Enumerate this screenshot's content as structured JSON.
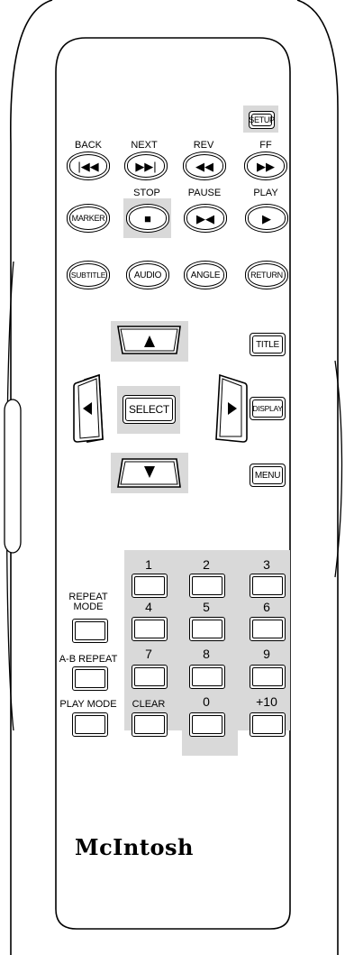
{
  "brand": "McIntosh",
  "labels": {
    "back": "BACK",
    "next": "NEXT",
    "rev": "REV",
    "ff": "FF",
    "stop": "STOP",
    "pause": "PAUSE",
    "play": "PLAY",
    "repeat_mode": "REPEAT\nMODE",
    "ab_repeat": "A-B  REPEAT"
  },
  "buttons": {
    "setup": "SETUP",
    "marker": "MARKER",
    "subtitle": "SUBTITLE",
    "audio": "AUDIO",
    "angle": "ANGLE",
    "return": "RETURN",
    "title": "TITLE",
    "display": "DISPLAY",
    "menu": "MENU",
    "select": "SELECT",
    "play_mode": "PLAY MODE",
    "clear": "CLEAR"
  },
  "digits": [
    "1",
    "2",
    "3",
    "4",
    "5",
    "6",
    "7",
    "8",
    "9",
    "0",
    "+10"
  ]
}
